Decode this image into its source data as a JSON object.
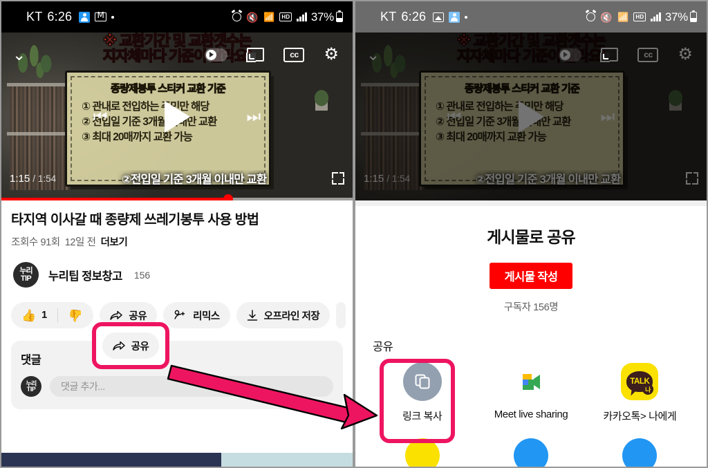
{
  "status_bar": {
    "carrier": "KT",
    "time": "6:26",
    "battery": "37%",
    "icons": [
      "photo-icon",
      "person-icon",
      "gmail-icon",
      "dot-icon",
      "alarm-icon",
      "mute-icon",
      "wifi-icon",
      "hd-icon",
      "signal-icon",
      "battery-icon"
    ]
  },
  "player": {
    "banner_line1": "※ 교환기간 및 교환갯수는",
    "banner_line2": "지자체마다 기준이 달라요!",
    "slide_title": "종량제봉투 스티커 교환 기준",
    "slide_lines": [
      "① 관내로 전입하는 주민만 해당",
      "② 전입일 기준 3개월 이내만 교환",
      "③ 최대 20매까지 교환 가능"
    ],
    "current_time": "1:15",
    "total_time": "1:54",
    "caption": "②전입일 기준 3개월 이내만 교환",
    "progress_percent": 64.5,
    "top_icons": [
      "chevron-down-icon",
      "autoplay-toggle",
      "cast-icon",
      "closed-caption-icon",
      "settings-gear-icon"
    ],
    "center_icons": [
      "previous-icon",
      "play-icon",
      "next-icon"
    ],
    "fullscreen_icon": "fullscreen-icon"
  },
  "video_info": {
    "title": "타지역 이사갈 때 종량제 쓰레기봉투 사용 방법",
    "views": "조회수 91회",
    "published": "12일 전",
    "more": "더보기",
    "channel_name": "누리팁 정보창고",
    "channel_subs": "156",
    "avatar_line1": "누리",
    "avatar_line2": "TIP"
  },
  "actions": {
    "like_count": "1",
    "share_label": "공유",
    "remix_label": "리믹스",
    "download_label": "오프라인 저장",
    "like_icon": "thumbs-up-icon",
    "dislike_icon": "thumbs-down-icon",
    "share_icon": "share-arrow-icon",
    "remix_icon": "remix-icon",
    "download_icon": "download-icon"
  },
  "comments": {
    "title": "댓글",
    "placeholder": "댓글 추가...",
    "avatar_line1": "누리",
    "avatar_line2": "TIP"
  },
  "share_sheet": {
    "title": "게시물로 공유",
    "cta_label": "게시물 작성",
    "subscribers": "구독자 156명",
    "share_section_label": "공유",
    "options": [
      {
        "label": "링크 복사",
        "icon": "copy-link-icon"
      },
      {
        "label": "Meet live sharing",
        "icon": "google-meet-icon"
      },
      {
        "label": "카카오톡> 나에게",
        "icon": "kakaotalk-icon"
      }
    ],
    "kakao_text": "TALK",
    "kakao_badge": "나"
  },
  "annotations": {
    "highlight_color": "#ee1560",
    "arrow_from": "share-button",
    "arrow_to": "copy-link-option"
  },
  "colors": {
    "accent_red": "#ff0000",
    "highlight_pink": "#ee1560",
    "chip_bg": "#f2f2f2",
    "nav_dark": "#2b3453",
    "nav_teal": "#c5dde0"
  }
}
